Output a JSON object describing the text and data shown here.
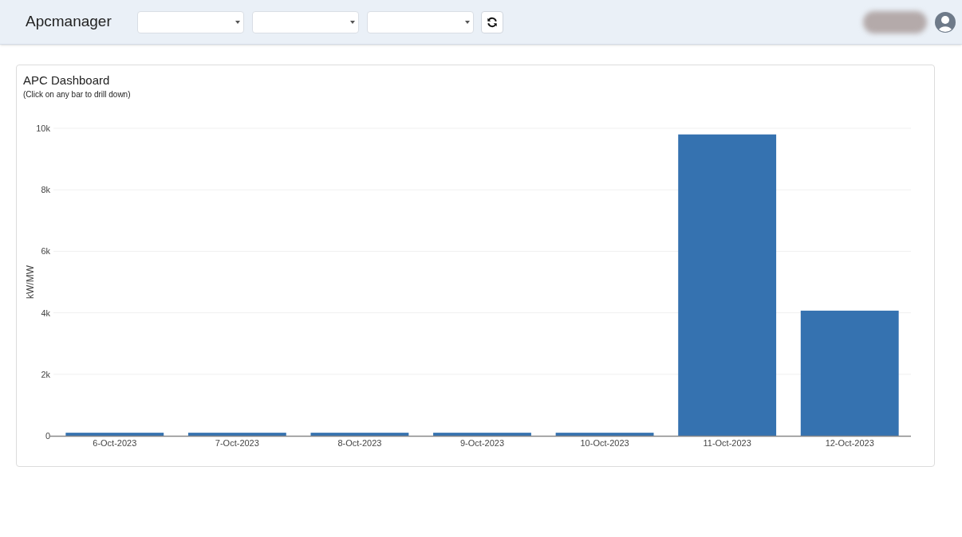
{
  "header": {
    "app_title": "Apcmanager",
    "filters": [
      {
        "kind": "dropdown"
      },
      {
        "kind": "dropdown"
      },
      {
        "kind": "dropdown"
      }
    ]
  },
  "dashboard": {
    "title": "APC Dashboard",
    "subtitle": "(Click on any bar to drill down)",
    "chart_data": {
      "type": "bar",
      "ylabel": "kW/MW",
      "categories": [
        "6-Oct-2023",
        "7-Oct-2023",
        "8-Oct-2023",
        "9-Oct-2023",
        "10-Oct-2023",
        "11-Oct-2023",
        "12-Oct-2023"
      ],
      "grid": true,
      "series": [
        {
          "color": "#3572b0",
          "values": [
            100,
            100,
            100,
            100,
            100,
            9800,
            4070
          ]
        }
      ],
      "ylim": [
        0,
        10000
      ],
      "yticks": [
        {
          "value": 0,
          "label": "0"
        },
        {
          "value": 2000,
          "label": "2k"
        },
        {
          "value": 4000,
          "label": "4k"
        },
        {
          "value": 6000,
          "label": "6k"
        },
        {
          "value": 8000,
          "label": "8k"
        },
        {
          "value": 10000,
          "label": "10k"
        }
      ]
    }
  }
}
